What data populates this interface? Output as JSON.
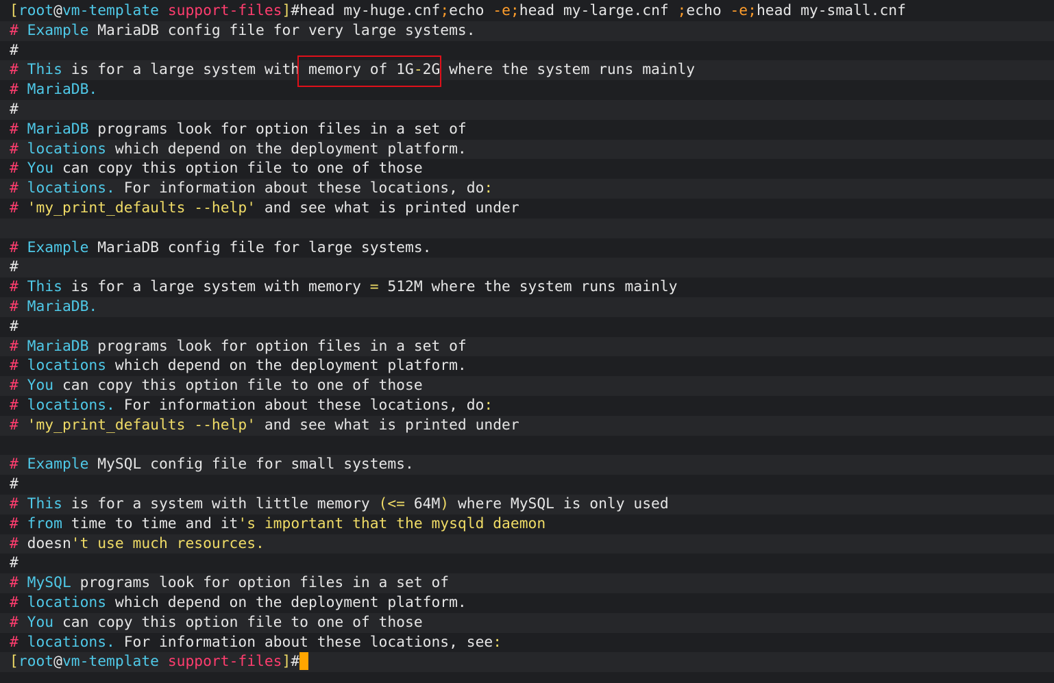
{
  "colors": {
    "background": "#1e1f22",
    "row_alt": "#26272a",
    "default_text": "#e6e6e6",
    "hash": "#ff3d6e",
    "keyword": "#4fc9e8",
    "string": "#f0dc66",
    "orange": "#ff9d2b",
    "prompt_bracket": "#f0dc66",
    "prompt_user": "#4fc9e8",
    "prompt_dir": "#ff3d6e",
    "cursor": "#ffa500",
    "highlight_box": "#e0101a"
  },
  "terminal": {
    "lines": [
      {
        "segs": [
          [
            "[",
            "#f0dc66"
          ],
          [
            "root",
            "#4fc9e8"
          ],
          [
            "@",
            "#e6e6e6"
          ],
          [
            "vm-template",
            "#4fc9e8"
          ],
          [
            " support-files",
            "#ff3d6e"
          ],
          [
            "]",
            "#f0dc66"
          ],
          [
            "#head my-huge.cnf",
            "#e6e6e6"
          ],
          [
            ";",
            "#ff9d2b"
          ],
          [
            "echo ",
            "#e6e6e6"
          ],
          [
            "-e",
            "#ff9d2b"
          ],
          [
            ";",
            "#ff9d2b"
          ],
          [
            "head my-large.cnf ",
            "#e6e6e6"
          ],
          [
            ";",
            "#ff9d2b"
          ],
          [
            "echo ",
            "#e6e6e6"
          ],
          [
            "-e",
            "#ff9d2b"
          ],
          [
            ";",
            "#ff9d2b"
          ],
          [
            "head my-small.cnf",
            "#e6e6e6"
          ]
        ]
      },
      {
        "segs": [
          [
            "# ",
            "#ff3d6e"
          ],
          [
            "Example ",
            "#4fc9e8"
          ],
          [
            "MariaDB config file for very large systems.",
            "#e6e6e6"
          ]
        ]
      },
      {
        "segs": [
          [
            "#",
            "#e6e6e6"
          ]
        ]
      },
      {
        "segs": [
          [
            "# ",
            "#ff3d6e"
          ],
          [
            "This ",
            "#4fc9e8"
          ],
          [
            "is for a large system with memory of 1G",
            "#e6e6e6"
          ],
          [
            "-",
            "#f0dc66"
          ],
          [
            "2G where the system runs mainly",
            "#e6e6e6"
          ]
        ]
      },
      {
        "segs": [
          [
            "# ",
            "#ff3d6e"
          ],
          [
            "MariaDB.",
            "#4fc9e8"
          ]
        ]
      },
      {
        "segs": [
          [
            "#",
            "#e6e6e6"
          ]
        ]
      },
      {
        "segs": [
          [
            "# ",
            "#ff3d6e"
          ],
          [
            "MariaDB ",
            "#4fc9e8"
          ],
          [
            "programs look for option files in a set of",
            "#e6e6e6"
          ]
        ]
      },
      {
        "segs": [
          [
            "# ",
            "#ff3d6e"
          ],
          [
            "locations ",
            "#4fc9e8"
          ],
          [
            "which depend on the deployment platform.",
            "#e6e6e6"
          ]
        ]
      },
      {
        "segs": [
          [
            "# ",
            "#ff3d6e"
          ],
          [
            "You ",
            "#4fc9e8"
          ],
          [
            "can copy this option file to one of those",
            "#e6e6e6"
          ]
        ]
      },
      {
        "segs": [
          [
            "# ",
            "#ff3d6e"
          ],
          [
            "locations. ",
            "#4fc9e8"
          ],
          [
            "For information about these locations, do",
            "#e6e6e6"
          ],
          [
            ":",
            "#f0dc66"
          ]
        ]
      },
      {
        "segs": [
          [
            "# ",
            "#ff3d6e"
          ],
          [
            "'my_print_defaults --help'",
            "#f0dc66"
          ],
          [
            " and see what is printed under",
            "#e6e6e6"
          ]
        ]
      },
      {
        "segs": [
          [
            "",
            "#e6e6e6"
          ]
        ]
      },
      {
        "segs": [
          [
            "# ",
            "#ff3d6e"
          ],
          [
            "Example ",
            "#4fc9e8"
          ],
          [
            "MariaDB config file for large systems.",
            "#e6e6e6"
          ]
        ]
      },
      {
        "segs": [
          [
            "#",
            "#e6e6e6"
          ]
        ]
      },
      {
        "segs": [
          [
            "# ",
            "#ff3d6e"
          ],
          [
            "This ",
            "#4fc9e8"
          ],
          [
            "is for a large system with memory ",
            "#e6e6e6"
          ],
          [
            "=",
            "#f0dc66"
          ],
          [
            " 512M where the system runs mainly",
            "#e6e6e6"
          ]
        ]
      },
      {
        "segs": [
          [
            "# ",
            "#ff3d6e"
          ],
          [
            "MariaDB.",
            "#4fc9e8"
          ]
        ]
      },
      {
        "segs": [
          [
            "#",
            "#e6e6e6"
          ]
        ]
      },
      {
        "segs": [
          [
            "# ",
            "#ff3d6e"
          ],
          [
            "MariaDB ",
            "#4fc9e8"
          ],
          [
            "programs look for option files in a set of",
            "#e6e6e6"
          ]
        ]
      },
      {
        "segs": [
          [
            "# ",
            "#ff3d6e"
          ],
          [
            "locations ",
            "#4fc9e8"
          ],
          [
            "which depend on the deployment platform.",
            "#e6e6e6"
          ]
        ]
      },
      {
        "segs": [
          [
            "# ",
            "#ff3d6e"
          ],
          [
            "You ",
            "#4fc9e8"
          ],
          [
            "can copy this option file to one of those",
            "#e6e6e6"
          ]
        ]
      },
      {
        "segs": [
          [
            "# ",
            "#ff3d6e"
          ],
          [
            "locations. ",
            "#4fc9e8"
          ],
          [
            "For information about these locations, do",
            "#e6e6e6"
          ],
          [
            ":",
            "#f0dc66"
          ]
        ]
      },
      {
        "segs": [
          [
            "# ",
            "#ff3d6e"
          ],
          [
            "'my_print_defaults --help'",
            "#f0dc66"
          ],
          [
            " and see what is printed under",
            "#e6e6e6"
          ]
        ]
      },
      {
        "segs": [
          [
            "",
            "#e6e6e6"
          ]
        ]
      },
      {
        "segs": [
          [
            "# ",
            "#ff3d6e"
          ],
          [
            "Example ",
            "#4fc9e8"
          ],
          [
            "MySQL config file for small systems.",
            "#e6e6e6"
          ]
        ]
      },
      {
        "segs": [
          [
            "#",
            "#e6e6e6"
          ]
        ]
      },
      {
        "segs": [
          [
            "# ",
            "#ff3d6e"
          ],
          [
            "This ",
            "#4fc9e8"
          ],
          [
            "is for a system with little memory ",
            "#e6e6e6"
          ],
          [
            "(<=",
            "#f0dc66"
          ],
          [
            " 64M",
            "#e6e6e6"
          ],
          [
            ")",
            "#f0dc66"
          ],
          [
            " where MySQL is only used",
            "#e6e6e6"
          ]
        ]
      },
      {
        "segs": [
          [
            "# ",
            "#ff3d6e"
          ],
          [
            "from ",
            "#4fc9e8"
          ],
          [
            "time to time and it",
            "#e6e6e6"
          ],
          [
            "'s important that the mysqld daemon",
            "#f0dc66"
          ]
        ]
      },
      {
        "segs": [
          [
            "# ",
            "#ff3d6e"
          ],
          [
            "doesn",
            "#e6e6e6"
          ],
          [
            "'t use much resources.",
            "#f0dc66"
          ]
        ]
      },
      {
        "segs": [
          [
            "#",
            "#e6e6e6"
          ]
        ]
      },
      {
        "segs": [
          [
            "# ",
            "#ff3d6e"
          ],
          [
            "MySQL ",
            "#4fc9e8"
          ],
          [
            "programs look for option files in a set of",
            "#e6e6e6"
          ]
        ]
      },
      {
        "segs": [
          [
            "# ",
            "#ff3d6e"
          ],
          [
            "locations ",
            "#4fc9e8"
          ],
          [
            "which depend on the deployment platform.",
            "#e6e6e6"
          ]
        ]
      },
      {
        "segs": [
          [
            "# ",
            "#ff3d6e"
          ],
          [
            "You ",
            "#4fc9e8"
          ],
          [
            "can copy this option file to one of those",
            "#e6e6e6"
          ]
        ]
      },
      {
        "segs": [
          [
            "# ",
            "#ff3d6e"
          ],
          [
            "locations. ",
            "#4fc9e8"
          ],
          [
            "For information about these locations, see",
            "#e6e6e6"
          ],
          [
            ":",
            "#f0dc66"
          ]
        ]
      },
      {
        "segs": [
          [
            "[",
            "#f0dc66"
          ],
          [
            "root",
            "#4fc9e8"
          ],
          [
            "@",
            "#e6e6e6"
          ],
          [
            "vm-template",
            "#4fc9e8"
          ],
          [
            " support-files",
            "#ff3d6e"
          ],
          [
            "]",
            "#f0dc66"
          ],
          [
            "#",
            "#e6e6e6"
          ]
        ],
        "cursor": true
      }
    ]
  }
}
